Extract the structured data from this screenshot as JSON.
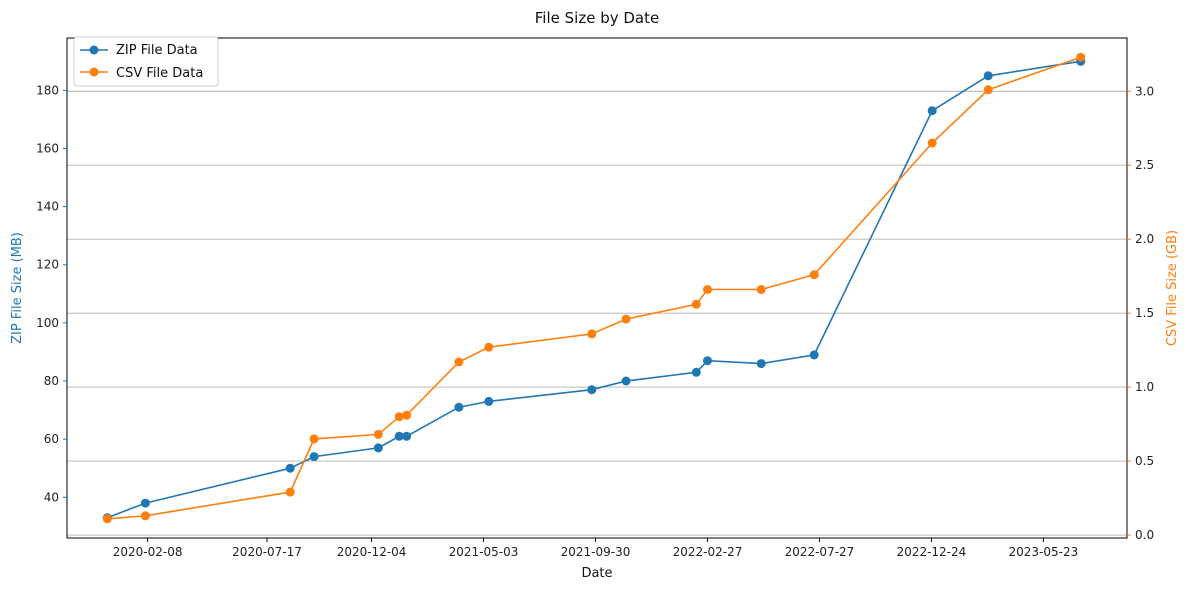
{
  "chart_data": {
    "type": "line",
    "title": "File Size by Date",
    "xlabel": "Date",
    "ylabel_left": "ZIP File Size (MB)",
    "ylabel_right": "CSV File Size (GB)",
    "x_ticks": [
      "2020-02-08",
      "2020-07-17",
      "2020-12-04",
      "2021-05-03",
      "2021-09-30",
      "2022-02-27",
      "2022-07-27",
      "2022-12-24",
      "2023-05-23"
    ],
    "y_left_ticks": [
      40,
      60,
      80,
      100,
      120,
      140,
      160,
      180
    ],
    "y_right_ticks": [
      "0.0",
      "0.5",
      "1.0",
      "1.5",
      "2.0",
      "2.5",
      "3.0"
    ],
    "y_left_range": [
      26,
      198
    ],
    "y_right_range": [
      -0.02,
      3.36
    ],
    "x_range": [
      "2019-10-23",
      "2023-09-12"
    ],
    "grid": "horizontal-right-axis",
    "legend_position": "top-left",
    "colors": {
      "zip": "#1f77b4",
      "csv": "#ff7f0e"
    },
    "series": [
      {
        "name": "ZIP File Data",
        "axis": "left",
        "color": "#1f77b4",
        "points": [
          [
            "2019-12-16",
            33
          ],
          [
            "2020-02-05",
            38
          ],
          [
            "2020-08-17",
            50
          ],
          [
            "2020-09-18",
            54
          ],
          [
            "2020-12-13",
            57
          ],
          [
            "2021-01-10",
            61
          ],
          [
            "2021-01-20",
            61
          ],
          [
            "2021-03-31",
            71
          ],
          [
            "2021-05-10",
            73
          ],
          [
            "2021-09-25",
            77
          ],
          [
            "2021-11-10",
            80
          ],
          [
            "2022-02-12",
            83
          ],
          [
            "2022-02-27",
            87
          ],
          [
            "2022-05-10",
            86
          ],
          [
            "2022-07-20",
            89
          ],
          [
            "2022-12-25",
            173
          ],
          [
            "2023-03-10",
            185
          ],
          [
            "2023-07-12",
            190
          ]
        ]
      },
      {
        "name": "CSV File Data",
        "axis": "right",
        "color": "#ff7f0e",
        "points": [
          [
            "2019-12-16",
            0.11
          ],
          [
            "2020-02-05",
            0.13
          ],
          [
            "2020-08-17",
            0.29
          ],
          [
            "2020-09-18",
            0.65
          ],
          [
            "2020-12-13",
            0.68
          ],
          [
            "2021-01-10",
            0.8
          ],
          [
            "2021-01-20",
            0.81
          ],
          [
            "2021-03-31",
            1.17
          ],
          [
            "2021-05-10",
            1.27
          ],
          [
            "2021-09-25",
            1.36
          ],
          [
            "2021-11-10",
            1.46
          ],
          [
            "2022-02-12",
            1.56
          ],
          [
            "2022-02-27",
            1.66
          ],
          [
            "2022-05-10",
            1.66
          ],
          [
            "2022-07-20",
            1.76
          ],
          [
            "2022-12-25",
            2.65
          ],
          [
            "2023-03-10",
            3.01
          ],
          [
            "2023-07-12",
            3.23
          ]
        ]
      }
    ]
  }
}
